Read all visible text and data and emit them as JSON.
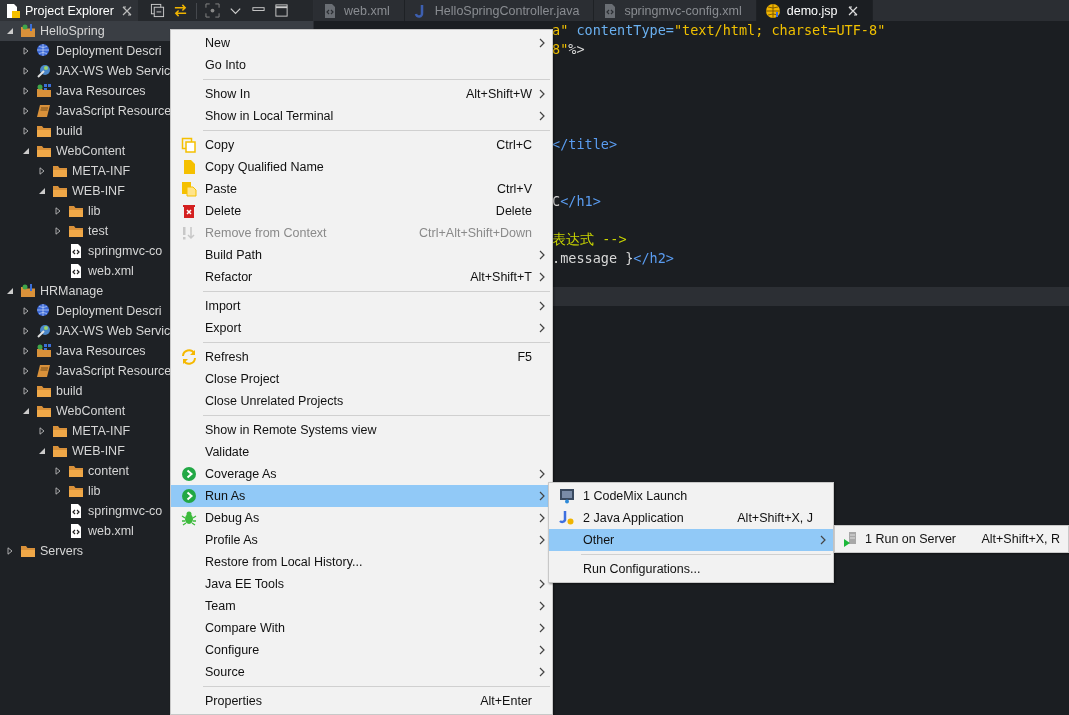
{
  "explorer": {
    "title": "Project Explorer",
    "tree": [
      {
        "label": "HelloSpring",
        "kind": "project",
        "expanded": true,
        "selected": true,
        "children": [
          {
            "label": "Deployment Descri",
            "kind": "descriptor",
            "expanded": false,
            "selected": false
          },
          {
            "label": "JAX-WS Web Servic",
            "kind": "webservices",
            "expanded": false,
            "selected": false
          },
          {
            "label": "Java Resources",
            "kind": "java-resources",
            "expanded": false,
            "selected": false
          },
          {
            "label": "JavaScript Resource",
            "kind": "js-resources",
            "expanded": false,
            "selected": false
          },
          {
            "label": "build",
            "kind": "folder",
            "expanded": false,
            "selected": false
          },
          {
            "label": "WebContent",
            "kind": "folder",
            "expanded": true,
            "selected": false,
            "children": [
              {
                "label": "META-INF",
                "kind": "folder",
                "expanded": false,
                "selected": false
              },
              {
                "label": "WEB-INF",
                "kind": "folder",
                "expanded": true,
                "selected": false,
                "children": [
                  {
                    "label": "lib",
                    "kind": "folder",
                    "expanded": false,
                    "selected": false
                  },
                  {
                    "label": "test",
                    "kind": "folder",
                    "expanded": false,
                    "selected": false
                  },
                  {
                    "label": "springmvc-co",
                    "kind": "file",
                    "selected": false
                  },
                  {
                    "label": "web.xml",
                    "kind": "file",
                    "selected": false
                  }
                ]
              }
            ]
          }
        ]
      },
      {
        "label": "HRManage",
        "kind": "project",
        "expanded": true,
        "selected": false,
        "children": [
          {
            "label": "Deployment Descri",
            "kind": "descriptor",
            "expanded": false,
            "selected": false
          },
          {
            "label": "JAX-WS Web Servic",
            "kind": "webservices",
            "expanded": false,
            "selected": false
          },
          {
            "label": "Java Resources",
            "kind": "java-resources",
            "expanded": false,
            "selected": false
          },
          {
            "label": "JavaScript Resource",
            "kind": "js-resources",
            "expanded": false,
            "selected": false
          },
          {
            "label": "build",
            "kind": "folder",
            "expanded": false,
            "selected": false
          },
          {
            "label": "WebContent",
            "kind": "folder",
            "expanded": true,
            "selected": false,
            "children": [
              {
                "label": "META-INF",
                "kind": "folder",
                "expanded": false,
                "selected": false
              },
              {
                "label": "WEB-INF",
                "kind": "folder",
                "expanded": true,
                "selected": false,
                "children": [
                  {
                    "label": "content",
                    "kind": "folder",
                    "expanded": false,
                    "selected": false
                  },
                  {
                    "label": "lib",
                    "kind": "folder",
                    "expanded": false,
                    "selected": false
                  },
                  {
                    "label": "springmvc-co",
                    "kind": "file",
                    "selected": false
                  },
                  {
                    "label": "web.xml",
                    "kind": "file",
                    "selected": false
                  }
                ]
              }
            ]
          }
        ]
      },
      {
        "label": "Servers",
        "kind": "folder",
        "expanded": false,
        "selected": false
      }
    ]
  },
  "editor_tabs": [
    {
      "label": "web.xml",
      "kind": "xml",
      "selected": false
    },
    {
      "label": "HelloSpringController.java",
      "kind": "java",
      "selected": false
    },
    {
      "label": "springmvc-config.xml",
      "kind": "xml",
      "selected": false
    },
    {
      "label": "demo.jsp",
      "kind": "jsp",
      "selected": true
    }
  ],
  "code_lines": [
    {
      "parts": [
        {
          "text": "a\" ",
          "kind": "string"
        },
        {
          "text": "contentType=",
          "kind": "attr"
        },
        {
          "text": "\"text/html; charset=UTF-8\"",
          "kind": "string"
        }
      ]
    },
    {
      "parts": [
        {
          "text": "8\"",
          "kind": "string"
        },
        {
          "text": "%>",
          "kind": "plain"
        }
      ]
    },
    {
      "parts": [
        {
          "text": "</title>",
          "kind": "tag"
        }
      ]
    },
    {
      "parts": [
        {
          "text": "C",
          "kind": "plain"
        },
        {
          "text": "</h1>",
          "kind": "tag"
        }
      ]
    },
    {
      "parts": [
        {
          "text": "表达式 -->",
          "kind": "comment"
        }
      ]
    },
    {
      "parts": [
        {
          "text": ".message }",
          "kind": "plain"
        },
        {
          "text": "</h2>",
          "kind": "tag"
        }
      ]
    }
  ],
  "current_line_highlight": true,
  "context_menu": [
    {
      "kind": "item",
      "label": "New",
      "submenu": true,
      "selected": false,
      "disabled": false
    },
    {
      "kind": "item",
      "label": "Go Into",
      "selected": false,
      "disabled": false
    },
    {
      "kind": "separator"
    },
    {
      "kind": "item",
      "label": "Show In",
      "shortcut": "Alt+Shift+W",
      "submenu": true,
      "selected": false,
      "disabled": false
    },
    {
      "kind": "item",
      "label": "Show in Local Terminal",
      "submenu": true,
      "selected": false,
      "disabled": false
    },
    {
      "kind": "separator"
    },
    {
      "kind": "item",
      "label": "Copy",
      "shortcut": "Ctrl+C",
      "selected": false,
      "disabled": false
    },
    {
      "kind": "item",
      "label": "Copy Qualified Name",
      "selected": false,
      "disabled": false
    },
    {
      "kind": "item",
      "label": "Paste",
      "shortcut": "Ctrl+V",
      "selected": false,
      "disabled": false
    },
    {
      "kind": "item",
      "label": "Delete",
      "shortcut": "Delete",
      "selected": false,
      "disabled": false
    },
    {
      "kind": "item",
      "label": "Remove from Context",
      "shortcut": "Ctrl+Alt+Shift+Down",
      "selected": false,
      "disabled": true
    },
    {
      "kind": "item",
      "label": "Build Path",
      "submenu": true,
      "selected": false,
      "disabled": false
    },
    {
      "kind": "item",
      "label": "Refactor",
      "shortcut": "Alt+Shift+T",
      "submenu": true,
      "selected": false,
      "disabled": false
    },
    {
      "kind": "separator"
    },
    {
      "kind": "item",
      "label": "Import",
      "submenu": true,
      "selected": false,
      "disabled": false
    },
    {
      "kind": "item",
      "label": "Export",
      "submenu": true,
      "selected": false,
      "disabled": false
    },
    {
      "kind": "separator"
    },
    {
      "kind": "item",
      "label": "Refresh",
      "shortcut": "F5",
      "selected": false,
      "disabled": false
    },
    {
      "kind": "item",
      "label": "Close Project",
      "selected": false,
      "disabled": false
    },
    {
      "kind": "item",
      "label": "Close Unrelated Projects",
      "selected": false,
      "disabled": false
    },
    {
      "kind": "separator"
    },
    {
      "kind": "item",
      "label": "Show in Remote Systems view",
      "selected": false,
      "disabled": false
    },
    {
      "kind": "item",
      "label": "Validate",
      "selected": false,
      "disabled": false
    },
    {
      "kind": "item",
      "label": "Coverage As",
      "submenu": true,
      "selected": false,
      "disabled": false
    },
    {
      "kind": "item",
      "label": "Run As",
      "submenu": true,
      "selected": true,
      "disabled": false
    },
    {
      "kind": "item",
      "label": "Debug As",
      "submenu": true,
      "selected": false,
      "disabled": false
    },
    {
      "kind": "item",
      "label": "Profile As",
      "submenu": true,
      "selected": false,
      "disabled": false
    },
    {
      "kind": "item",
      "label": "Restore from Local History...",
      "selected": false,
      "disabled": false
    },
    {
      "kind": "item",
      "label": "Java EE Tools",
      "submenu": true,
      "selected": false,
      "disabled": false
    },
    {
      "kind": "item",
      "label": "Team",
      "submenu": true,
      "selected": false,
      "disabled": false
    },
    {
      "kind": "item",
      "label": "Compare With",
      "submenu": true,
      "selected": false,
      "disabled": false
    },
    {
      "kind": "item",
      "label": "Configure",
      "submenu": true,
      "selected": false,
      "disabled": false
    },
    {
      "kind": "item",
      "label": "Source",
      "submenu": true,
      "selected": false,
      "disabled": false
    },
    {
      "kind": "separator"
    },
    {
      "kind": "item",
      "label": "Properties",
      "shortcut": "Alt+Enter",
      "selected": false,
      "disabled": false
    }
  ],
  "run_as_menu": [
    {
      "kind": "item",
      "label": "1 CodeMix Launch",
      "selected": false
    },
    {
      "kind": "item",
      "label": "2 Java Application",
      "shortcut": "Alt+Shift+X, J",
      "selected": false
    },
    {
      "kind": "item",
      "label": "Other",
      "submenu": true,
      "selected": true
    },
    {
      "kind": "separator"
    },
    {
      "kind": "item",
      "label": "Run Configurations...",
      "selected": false
    }
  ],
  "other_menu": [
    {
      "kind": "item",
      "label": "1 Run on Server",
      "shortcut": "Alt+Shift+X, R",
      "selected": false
    }
  ]
}
